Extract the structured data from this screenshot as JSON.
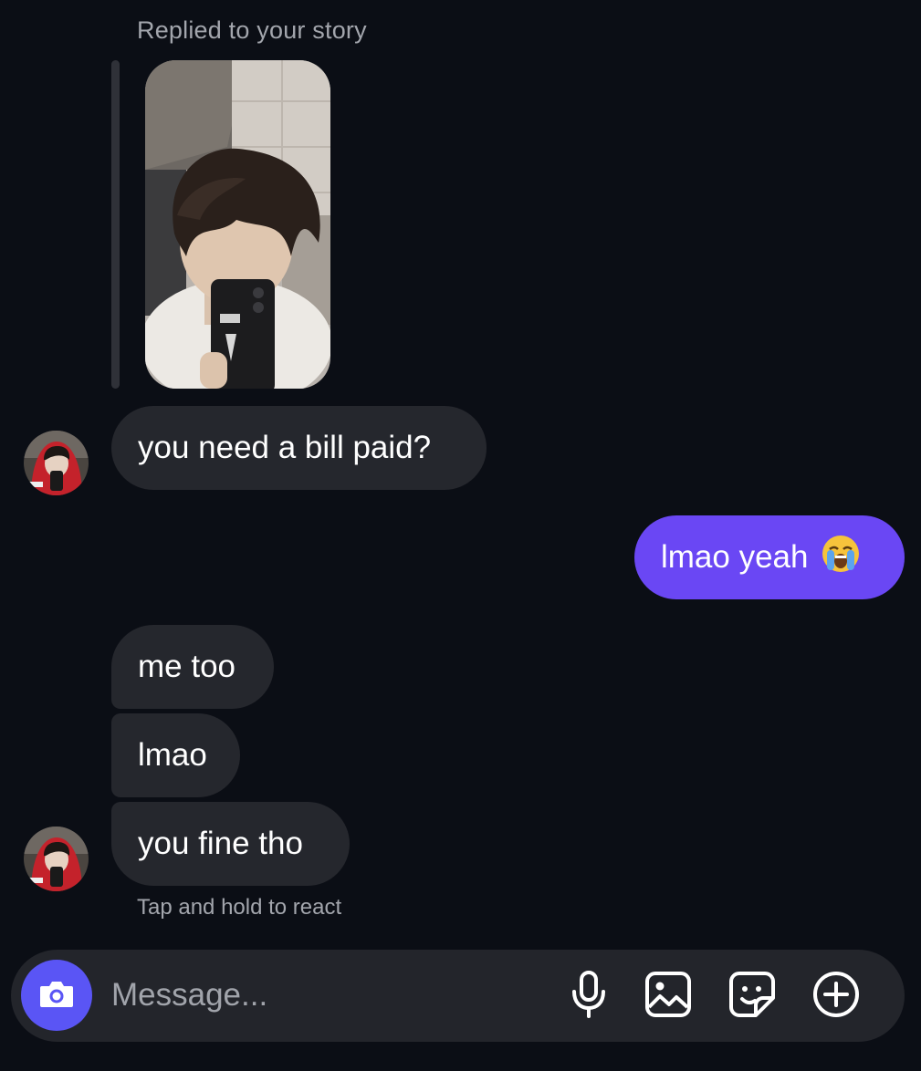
{
  "thread": {
    "replied_label": "Replied to your story",
    "messages": [
      {
        "from": "them",
        "text": "you need a bill paid?"
      },
      {
        "from": "me",
        "text": "lmao yeah",
        "emoji": "loudly-crying-face"
      },
      {
        "from": "them",
        "text": "me too"
      },
      {
        "from": "them",
        "text": "lmao"
      },
      {
        "from": "them",
        "text": "you fine tho"
      }
    ],
    "hint": "Tap and hold to react"
  },
  "composer": {
    "placeholder": "Message...",
    "icons": [
      "camera-icon",
      "microphone-icon",
      "gallery-icon",
      "sticker-icon",
      "plus-icon"
    ]
  },
  "colors": {
    "background": "#0b0e15",
    "incoming_bubble": "#25272d",
    "outgoing_bubble": "#6a47f4",
    "camera_button": "#5a55f5"
  }
}
